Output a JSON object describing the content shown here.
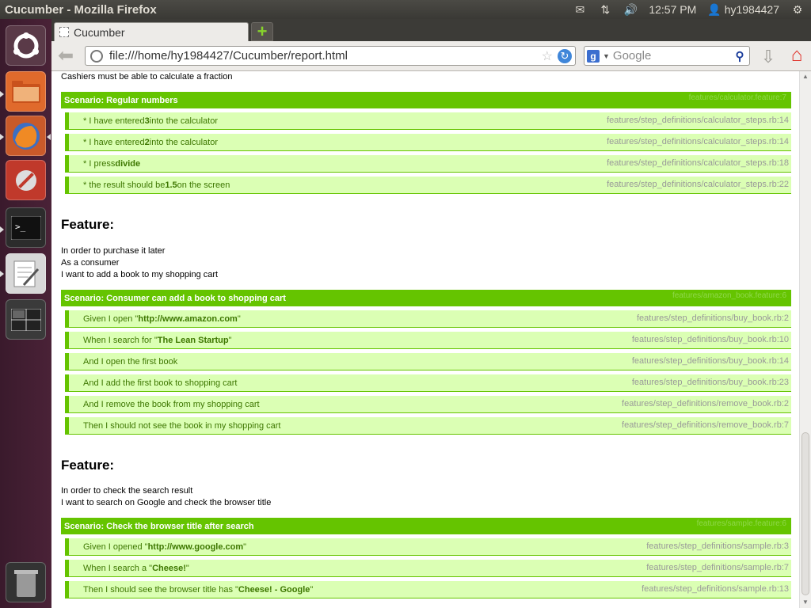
{
  "window": {
    "title": "Cucumber - Mozilla Firefox"
  },
  "tray": {
    "time": "12:57 PM",
    "user": "hy1984427"
  },
  "tab": {
    "label": "Cucumber"
  },
  "nav": {
    "url": "file:///home/hy1984427/Cucumber/report.html",
    "search_placeholder": "Google"
  },
  "report": {
    "intro_line": "Cashiers must be able to calculate a fraction",
    "scenario1": {
      "title": "Scenario: Regular numbers",
      "location": "features/calculator.feature:7",
      "steps": [
        {
          "pre": "* I have entered ",
          "bold": "3",
          "post": " into the calculator",
          "file": "features/step_definitions/calculator_steps.rb:14"
        },
        {
          "pre": "* I have entered ",
          "bold": "2",
          "post": " into the calculator",
          "file": "features/step_definitions/calculator_steps.rb:14"
        },
        {
          "pre": "* I press ",
          "bold": "divide",
          "post": "",
          "file": "features/step_definitions/calculator_steps.rb:18"
        },
        {
          "pre": "* the result should be ",
          "bold": "1.5",
          "post": " on the screen",
          "file": "features/step_definitions/calculator_steps.rb:22"
        }
      ]
    },
    "feature2": {
      "heading": "Feature:",
      "lines": [
        "In order to purchase it later",
        "As a consumer",
        "I want to add a book to my shopping cart"
      ],
      "scenario": {
        "title": "Scenario: Consumer can add a book to shopping cart",
        "location": "features/amazon_book.feature:6",
        "steps": [
          {
            "pre": "Given I open \"",
            "bold": "http://www.amazon.com",
            "post": "\"",
            "file": "features/step_definitions/buy_book.rb:2"
          },
          {
            "pre": "When I search for \"",
            "bold": "The Lean Startup",
            "post": "\"",
            "file": "features/step_definitions/buy_book.rb:10"
          },
          {
            "pre": "And I open the first book",
            "bold": "",
            "post": "",
            "file": "features/step_definitions/buy_book.rb:14"
          },
          {
            "pre": "And I add the first book to shopping cart",
            "bold": "",
            "post": "",
            "file": "features/step_definitions/buy_book.rb:23"
          },
          {
            "pre": "And I remove the book from my shopping cart",
            "bold": "",
            "post": "",
            "file": "features/step_definitions/remove_book.rb:2"
          },
          {
            "pre": "Then I should not see the book in my shopping cart",
            "bold": "",
            "post": "",
            "file": "features/step_definitions/remove_book.rb:7"
          }
        ]
      }
    },
    "feature3": {
      "heading": "Feature:",
      "lines": [
        "In order to check the search result",
        "I want to search on Google and check the browser title"
      ],
      "scenario": {
        "title": "Scenario: Check the browser title after search",
        "location": "features/sample.feature:6",
        "steps": [
          {
            "pre": "Given I opened \"",
            "bold": "http://www.google.com",
            "post": "\"",
            "file": "features/step_definitions/sample.rb:3"
          },
          {
            "pre": "When I search a \"",
            "bold": "Cheese!",
            "post": "\"",
            "file": "features/step_definitions/sample.rb:7"
          },
          {
            "pre": "Then I should see the browser title has \"",
            "bold": "Cheese! - Google",
            "post": "\"",
            "file": "features/step_definitions/sample.rb:13"
          }
        ]
      }
    }
  },
  "colors": {
    "passed": "#65c400",
    "step_bg": "#dbffb4",
    "step_text": "#3d7700"
  }
}
